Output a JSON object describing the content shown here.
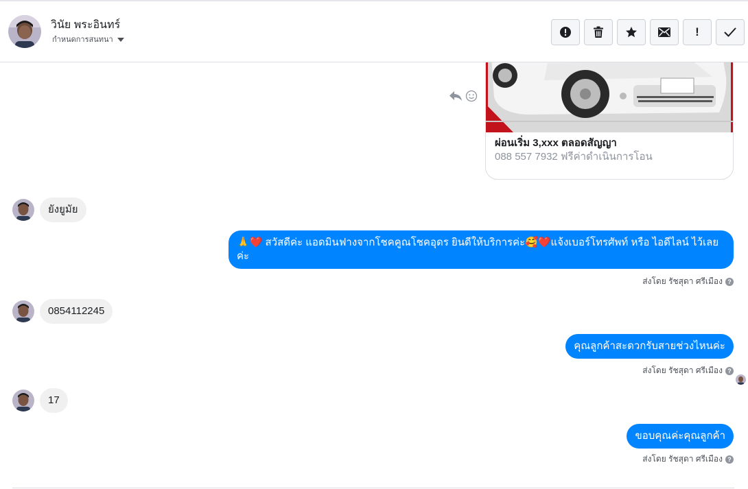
{
  "contact": {
    "name": "วินัย พระอินทร์",
    "assign_label": "กำหนดการสนทนา"
  },
  "actions": [
    {
      "name": "mark-spam-button",
      "icon": "alert-circle-icon"
    },
    {
      "name": "delete-button",
      "icon": "trash-icon"
    },
    {
      "name": "star-button",
      "icon": "star-icon"
    },
    {
      "name": "mark-unread-button",
      "icon": "envelope-icon"
    },
    {
      "name": "follow-up-button",
      "icon": "exclamation-icon",
      "label": "!"
    },
    {
      "name": "mark-done-button",
      "icon": "check-icon"
    }
  ],
  "card": {
    "title": "ผ่อนเริ่ม 3,xxx ตลอดสัญญา",
    "subtitle": "088 557 7932 ฟรีค่าดำเนินการโอน"
  },
  "messages": [
    {
      "direction": "in",
      "text": "ยังยูมัย"
    },
    {
      "direction": "out",
      "line1": "🙏❤️ สวัสดีค่ะ แอดมินฟางจากโชคคูณโชคอุดร ยินดีให้บริการค่ะ🥰❤️แจ้งเบอร์โทรศัพท์ หรือ ไอดีไลน์  ไว้เลย",
      "line2": "ค่ะ",
      "sent_by": "ส่งโดย รัชสุดา ศรีเมือง"
    },
    {
      "direction": "in",
      "text": "0854112245"
    },
    {
      "direction": "out",
      "text": "คุณลูกค้าสะดวกรับสายช่วงไหนค่ะ",
      "sent_by": "ส่งโดย รัชสุดา ศรีเมือง"
    },
    {
      "direction": "in",
      "text": "17"
    },
    {
      "direction": "out",
      "text": "ขอบคุณค่ะคุณลูกค้า",
      "sent_by": "ส่งโดย รัชสุดา ศรีเมือง"
    }
  ],
  "help_icon_char": "?",
  "colors": {
    "outgoing_bubble": "#0084ff",
    "incoming_bubble": "#f0f0f0",
    "header_border": "#dadde1"
  }
}
